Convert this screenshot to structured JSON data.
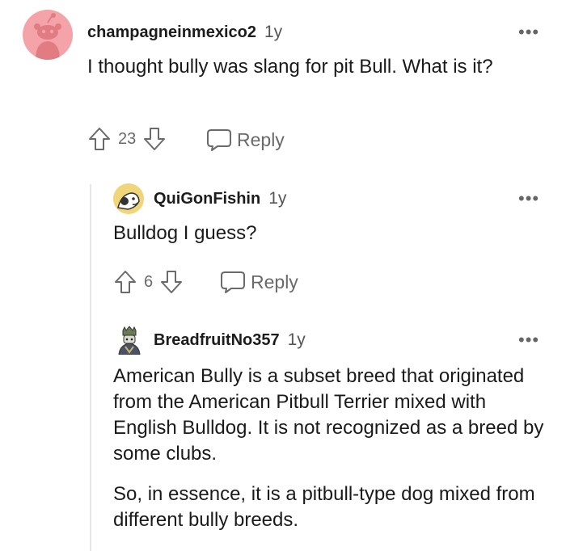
{
  "comments": [
    {
      "username": "champagneinmexico2",
      "age": "1y",
      "body": [
        "I thought bully was slang for pit Bull. What is it?"
      ],
      "score": "23",
      "reply_label": "Reply"
    },
    {
      "username": "QuiGonFishin",
      "age": "1y",
      "body": [
        "Bulldog I guess?"
      ],
      "score": "6",
      "reply_label": "Reply"
    },
    {
      "username": "BreadfruitNo357",
      "age": "1y",
      "body": [
        "American Bully is a subset breed that originated from the American Pitbull Terrier mixed with English Bulldog. It is not recognized as a breed by some clubs.",
        "So, in essence, it is a pitbull-type dog mixed from different bully breeds."
      ]
    }
  ],
  "more_label": "•••",
  "colors": {
    "avatar1_bg": "#f4a4a8",
    "text": "#1a1a1b",
    "meta": "#6a6a6a",
    "thread": "#e6e6e6"
  },
  "icons": [
    "snoo-avatar",
    "fisher-avatar",
    "knight-avatar",
    "upvote-icon",
    "downvote-icon",
    "comment-bubble-icon"
  ]
}
